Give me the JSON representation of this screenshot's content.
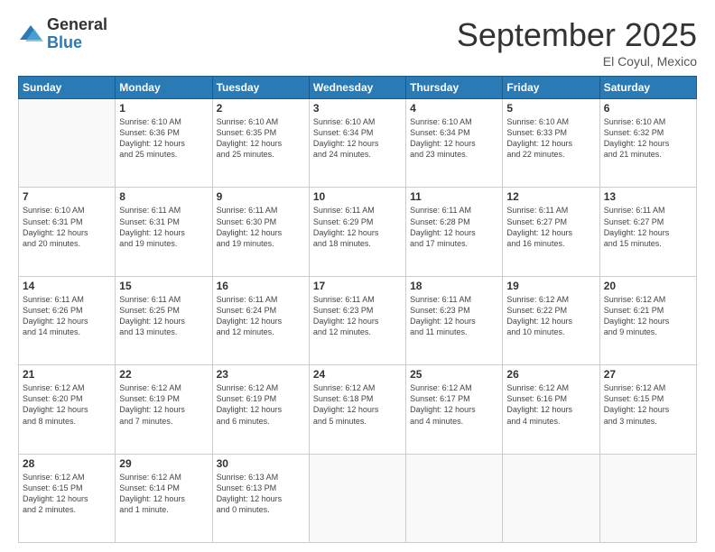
{
  "logo": {
    "general": "General",
    "blue": "Blue"
  },
  "title": "September 2025",
  "subtitle": "El Coyul, Mexico",
  "headers": [
    "Sunday",
    "Monday",
    "Tuesday",
    "Wednesday",
    "Thursday",
    "Friday",
    "Saturday"
  ],
  "weeks": [
    [
      {
        "day": "",
        "info": ""
      },
      {
        "day": "1",
        "info": "Sunrise: 6:10 AM\nSunset: 6:36 PM\nDaylight: 12 hours\nand 25 minutes."
      },
      {
        "day": "2",
        "info": "Sunrise: 6:10 AM\nSunset: 6:35 PM\nDaylight: 12 hours\nand 25 minutes."
      },
      {
        "day": "3",
        "info": "Sunrise: 6:10 AM\nSunset: 6:34 PM\nDaylight: 12 hours\nand 24 minutes."
      },
      {
        "day": "4",
        "info": "Sunrise: 6:10 AM\nSunset: 6:34 PM\nDaylight: 12 hours\nand 23 minutes."
      },
      {
        "day": "5",
        "info": "Sunrise: 6:10 AM\nSunset: 6:33 PM\nDaylight: 12 hours\nand 22 minutes."
      },
      {
        "day": "6",
        "info": "Sunrise: 6:10 AM\nSunset: 6:32 PM\nDaylight: 12 hours\nand 21 minutes."
      }
    ],
    [
      {
        "day": "7",
        "info": "Sunrise: 6:10 AM\nSunset: 6:31 PM\nDaylight: 12 hours\nand 20 minutes."
      },
      {
        "day": "8",
        "info": "Sunrise: 6:11 AM\nSunset: 6:31 PM\nDaylight: 12 hours\nand 19 minutes."
      },
      {
        "day": "9",
        "info": "Sunrise: 6:11 AM\nSunset: 6:30 PM\nDaylight: 12 hours\nand 19 minutes."
      },
      {
        "day": "10",
        "info": "Sunrise: 6:11 AM\nSunset: 6:29 PM\nDaylight: 12 hours\nand 18 minutes."
      },
      {
        "day": "11",
        "info": "Sunrise: 6:11 AM\nSunset: 6:28 PM\nDaylight: 12 hours\nand 17 minutes."
      },
      {
        "day": "12",
        "info": "Sunrise: 6:11 AM\nSunset: 6:27 PM\nDaylight: 12 hours\nand 16 minutes."
      },
      {
        "day": "13",
        "info": "Sunrise: 6:11 AM\nSunset: 6:27 PM\nDaylight: 12 hours\nand 15 minutes."
      }
    ],
    [
      {
        "day": "14",
        "info": "Sunrise: 6:11 AM\nSunset: 6:26 PM\nDaylight: 12 hours\nand 14 minutes."
      },
      {
        "day": "15",
        "info": "Sunrise: 6:11 AM\nSunset: 6:25 PM\nDaylight: 12 hours\nand 13 minutes."
      },
      {
        "day": "16",
        "info": "Sunrise: 6:11 AM\nSunset: 6:24 PM\nDaylight: 12 hours\nand 12 minutes."
      },
      {
        "day": "17",
        "info": "Sunrise: 6:11 AM\nSunset: 6:23 PM\nDaylight: 12 hours\nand 12 minutes."
      },
      {
        "day": "18",
        "info": "Sunrise: 6:11 AM\nSunset: 6:23 PM\nDaylight: 12 hours\nand 11 minutes."
      },
      {
        "day": "19",
        "info": "Sunrise: 6:12 AM\nSunset: 6:22 PM\nDaylight: 12 hours\nand 10 minutes."
      },
      {
        "day": "20",
        "info": "Sunrise: 6:12 AM\nSunset: 6:21 PM\nDaylight: 12 hours\nand 9 minutes."
      }
    ],
    [
      {
        "day": "21",
        "info": "Sunrise: 6:12 AM\nSunset: 6:20 PM\nDaylight: 12 hours\nand 8 minutes."
      },
      {
        "day": "22",
        "info": "Sunrise: 6:12 AM\nSunset: 6:19 PM\nDaylight: 12 hours\nand 7 minutes."
      },
      {
        "day": "23",
        "info": "Sunrise: 6:12 AM\nSunset: 6:19 PM\nDaylight: 12 hours\nand 6 minutes."
      },
      {
        "day": "24",
        "info": "Sunrise: 6:12 AM\nSunset: 6:18 PM\nDaylight: 12 hours\nand 5 minutes."
      },
      {
        "day": "25",
        "info": "Sunrise: 6:12 AM\nSunset: 6:17 PM\nDaylight: 12 hours\nand 4 minutes."
      },
      {
        "day": "26",
        "info": "Sunrise: 6:12 AM\nSunset: 6:16 PM\nDaylight: 12 hours\nand 4 minutes."
      },
      {
        "day": "27",
        "info": "Sunrise: 6:12 AM\nSunset: 6:15 PM\nDaylight: 12 hours\nand 3 minutes."
      }
    ],
    [
      {
        "day": "28",
        "info": "Sunrise: 6:12 AM\nSunset: 6:15 PM\nDaylight: 12 hours\nand 2 minutes."
      },
      {
        "day": "29",
        "info": "Sunrise: 6:12 AM\nSunset: 6:14 PM\nDaylight: 12 hours\nand 1 minute."
      },
      {
        "day": "30",
        "info": "Sunrise: 6:13 AM\nSunset: 6:13 PM\nDaylight: 12 hours\nand 0 minutes."
      },
      {
        "day": "",
        "info": ""
      },
      {
        "day": "",
        "info": ""
      },
      {
        "day": "",
        "info": ""
      },
      {
        "day": "",
        "info": ""
      }
    ]
  ]
}
